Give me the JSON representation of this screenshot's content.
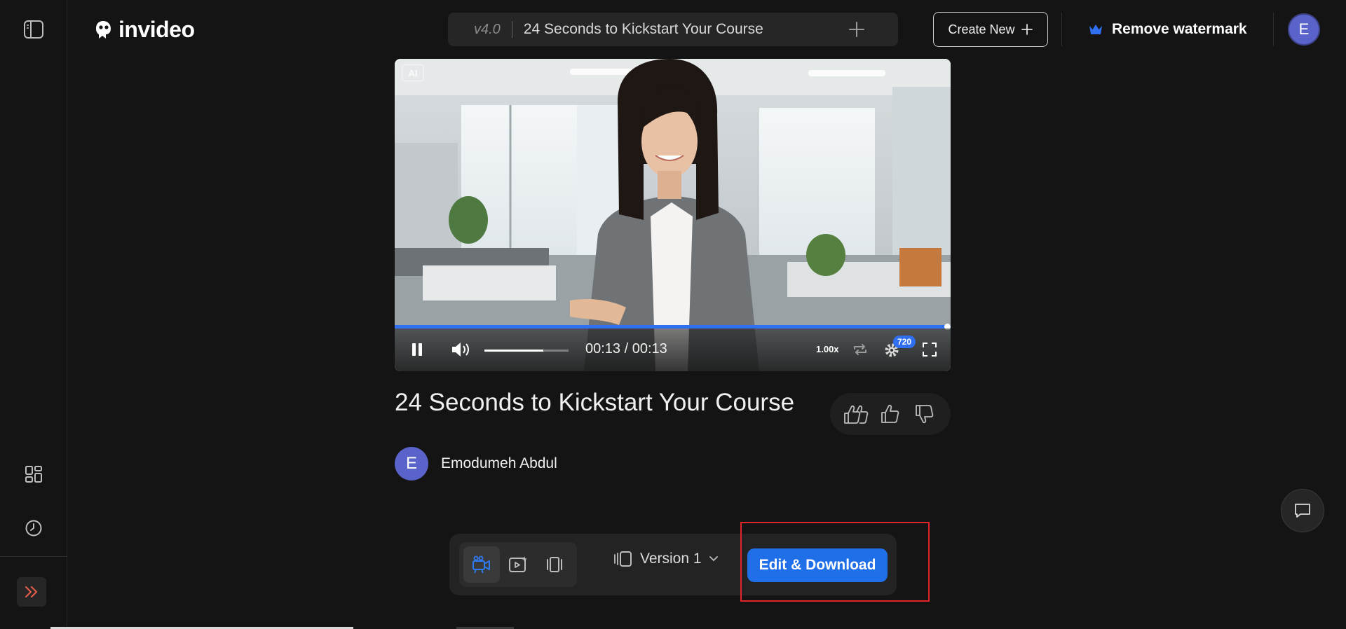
{
  "brand": {
    "name": "invideo"
  },
  "header": {
    "version": "v4.0",
    "project_title": "24 Seconds to Kickstart Your Course",
    "create_new_label": "Create New",
    "remove_watermark_label": "Remove watermark",
    "avatar_initial": "E"
  },
  "player": {
    "ai_badge": "AI",
    "time_display": "00:13 / 00:13",
    "progress": 1.0,
    "volume": 0.7,
    "speed": "1.00x",
    "quality": "720"
  },
  "video": {
    "title": "24 Seconds to Kickstart Your Course",
    "author_initial": "E",
    "author_name": "Emodumeh Abdul"
  },
  "toolbar": {
    "version_label": "Version 1",
    "edit_download_label": "Edit & Download"
  },
  "colors": {
    "accent": "#1f6fe8",
    "highlight": "#e0262a",
    "avatar": "#5a63c9",
    "crown": "#2f6ff0"
  }
}
